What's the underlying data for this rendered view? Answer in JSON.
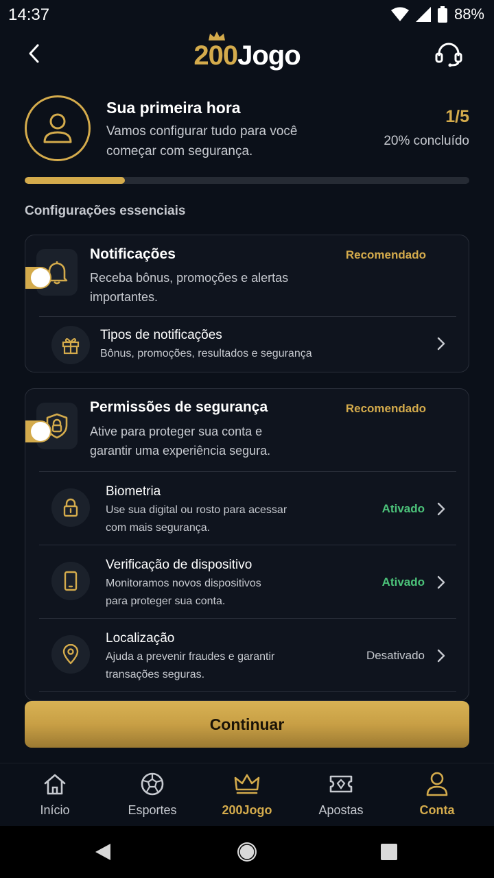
{
  "status": {
    "time": "14:37",
    "battery": "88%"
  },
  "header": {
    "logo_number": "200",
    "logo_word": "Jogo"
  },
  "intro": {
    "title": "Sua primeira hora",
    "subtitle_line1": "Vamos configurar tudo para você",
    "subtitle_line2": "começar com segurança.",
    "step": "1/5",
    "progress_text": "20% concluído",
    "progress_fraction": 0.2
  },
  "section_title": "Configurações essenciais",
  "notifications_card": {
    "title": "Notificações",
    "badge": "Recomendado",
    "desc_line1": "Receba bônus, promoções e alertas",
    "desc_line2": "importantes.",
    "toggle_on": true,
    "sub": {
      "title": "Tipos de notificações",
      "desc": "Bônus, promoções, resultados e segurança"
    }
  },
  "security_card": {
    "title": "Permissões de segurança",
    "badge": "Recomendado",
    "desc_line1": "Ative para proteger sua conta e",
    "desc_line2": "garantir uma experiência segura.",
    "toggle_on": true,
    "rows": [
      {
        "title": "Biometria",
        "desc_line1": "Use sua digital ou rosto para acessar",
        "desc_line2": "com mais segurança.",
        "status": "Ativado"
      },
      {
        "title": "Verificação de dispositivo",
        "desc_line1": "Monitoramos novos dispositivos",
        "desc_line2": "para proteger sua conta.",
        "status": "Ativado"
      },
      {
        "title": "Localização",
        "desc_line1": "Ajuda a prevenir fraudes e garantir",
        "desc_line2": "transações seguras.",
        "status": "Desativado"
      }
    ]
  },
  "continue_label": "Continuar",
  "nav": [
    {
      "label": "Início",
      "icon": "home-icon"
    },
    {
      "label": "Esportes",
      "icon": "soccer-ball-icon"
    },
    {
      "label": "200Jogo",
      "icon": "crown-icon"
    },
    {
      "label": "Apostas",
      "icon": "ticket-icon"
    },
    {
      "label": "Conta",
      "icon": "user-icon"
    }
  ],
  "colors": {
    "accent": "#d4ab4c",
    "success": "#4cc37a",
    "background": "#0b1019"
  }
}
